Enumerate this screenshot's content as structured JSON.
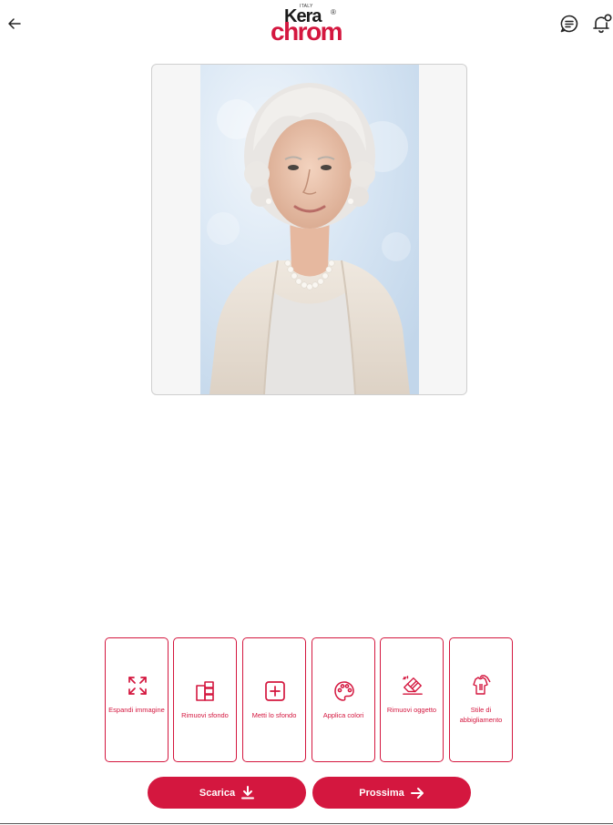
{
  "header": {
    "logo": {
      "top": "ITALY",
      "line1": "Kera",
      "line2": "chrom",
      "mark": "®"
    },
    "icons": {
      "back": "arrow-left-icon",
      "chat": "chat-lines-icon",
      "notifications": "bell-notification-icon"
    }
  },
  "image": {
    "subject": "portrait of elderly woman with white hair and pearl necklace",
    "colors": {
      "background": "#dce9f6",
      "frame": "#f6f6f6"
    }
  },
  "tools": [
    {
      "label": "Espandi immagine",
      "icon": "expand-arrows-icon"
    },
    {
      "label": "Rimuovi sfondo",
      "icon": "remove-background-icon"
    },
    {
      "label": "Metti lo sfondo",
      "icon": "add-background-icon"
    },
    {
      "label": "Applica colori",
      "icon": "palette-icon"
    },
    {
      "label": "Rimuovi oggetto",
      "icon": "eraser-icon"
    },
    {
      "label": "Stile di abbigliamento",
      "icon": "shirt-style-icon"
    }
  ],
  "actions": {
    "download_label": "Scarica",
    "next_label": "Prossima"
  },
  "colors": {
    "accent": "#d4173f",
    "text": "#1a1a1a"
  }
}
